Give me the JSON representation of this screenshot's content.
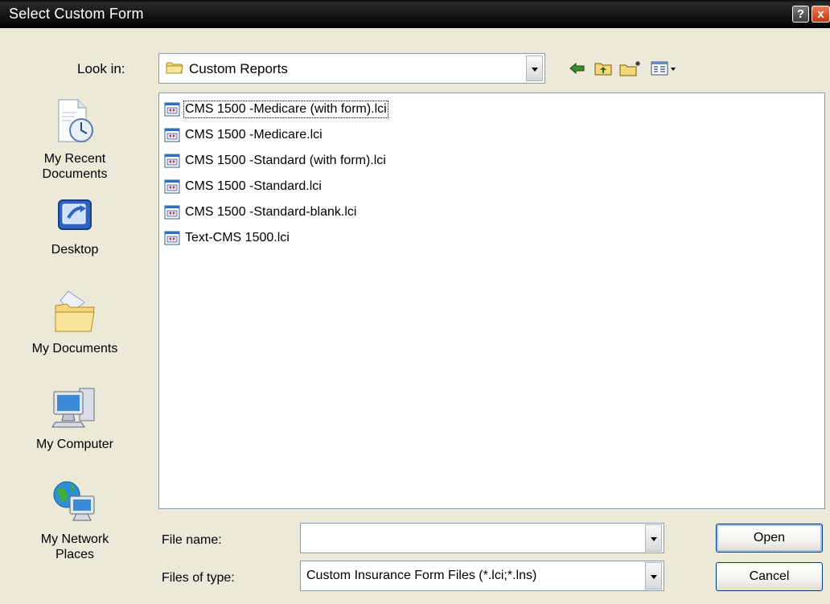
{
  "window": {
    "title": "Select Custom Form",
    "help_glyph": "?",
    "close_glyph": "x"
  },
  "look_in": {
    "label": "Look in:",
    "value": "Custom Reports",
    "icon": "folder-icon"
  },
  "toolbar": {
    "icons": [
      "back-arrow-icon",
      "up-one-level-icon",
      "new-folder-icon",
      "view-menu-icon"
    ]
  },
  "places": [
    {
      "label": "My Recent\nDocuments",
      "icon": "recent-documents-icon"
    },
    {
      "label": "Desktop",
      "icon": "desktop-icon"
    },
    {
      "label": "My Documents",
      "icon": "my-documents-icon"
    },
    {
      "label": "My Computer",
      "icon": "my-computer-icon"
    },
    {
      "label": "My Network\nPlaces",
      "icon": "network-places-icon"
    }
  ],
  "files": [
    {
      "name": "CMS 1500 -Medicare (with form).lci"
    },
    {
      "name": "CMS 1500 -Medicare.lci"
    },
    {
      "name": "CMS 1500 -Standard (with form).lci"
    },
    {
      "name": "CMS 1500 -Standard.lci"
    },
    {
      "name": "CMS 1500 -Standard-blank.lci"
    },
    {
      "name": "Text-CMS 1500.lci"
    }
  ],
  "file_name": {
    "label": "File name:",
    "value": ""
  },
  "file_type": {
    "label": "Files of type:",
    "value": "Custom Insurance Form Files (*.lci;*.lns)"
  },
  "buttons": {
    "open": "Open",
    "cancel": "Cancel"
  }
}
